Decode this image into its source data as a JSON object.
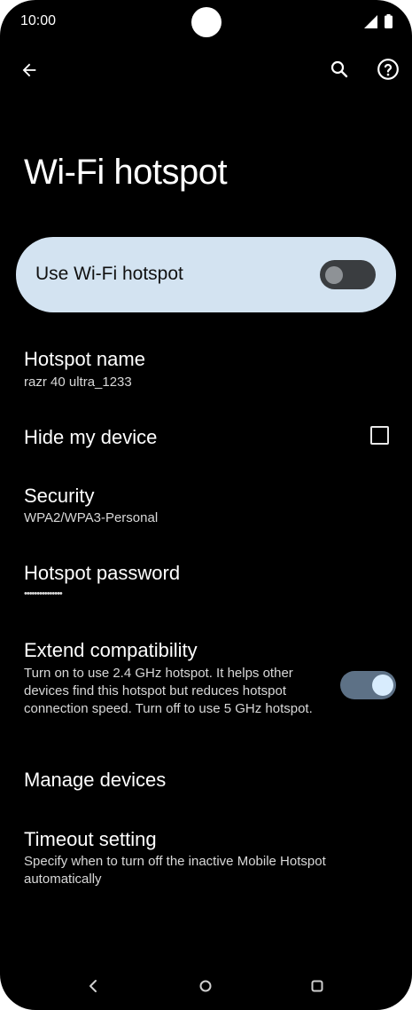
{
  "status_bar": {
    "time": "10:00"
  },
  "page": {
    "title": "Wi-Fi hotspot"
  },
  "main_toggle": {
    "label": "Use Wi-Fi hotspot",
    "enabled": false
  },
  "settings": {
    "hotspot_name": {
      "title": "Hotspot name",
      "value": "razr 40 ultra_1233"
    },
    "hide_device": {
      "title": "Hide my device",
      "checked": false
    },
    "security": {
      "title": "Security",
      "value": "WPA2/WPA3-Personal"
    },
    "password": {
      "title": "Hotspot password",
      "value": "•••••••••••••••"
    },
    "extend_compat": {
      "title": "Extend compatibility",
      "description": "Turn on to use 2.4 GHz hotspot. It helps other devices find this hotspot but reduces hotspot connection speed. Turn off to use 5 GHz hotspot.",
      "enabled": true
    },
    "manage_devices": {
      "title": "Manage devices"
    },
    "timeout": {
      "title": "Timeout setting",
      "description": "Specify when to turn off the inactive Mobile Hotspot automatically"
    }
  },
  "icons": {
    "back": "arrow-back-icon",
    "search": "search-icon",
    "help": "help-circle-icon",
    "signal": "cell-signal-icon",
    "battery": "battery-icon",
    "nav_back": "nav-back-icon",
    "nav_home": "nav-home-icon",
    "nav_recents": "nav-recents-icon"
  },
  "colors": {
    "background": "#000000",
    "card": "#d3e3f1",
    "switch_on_track": "#5d7186",
    "switch_on_thumb": "#d8ecfd",
    "switch_off_track": "#3a3d40"
  }
}
